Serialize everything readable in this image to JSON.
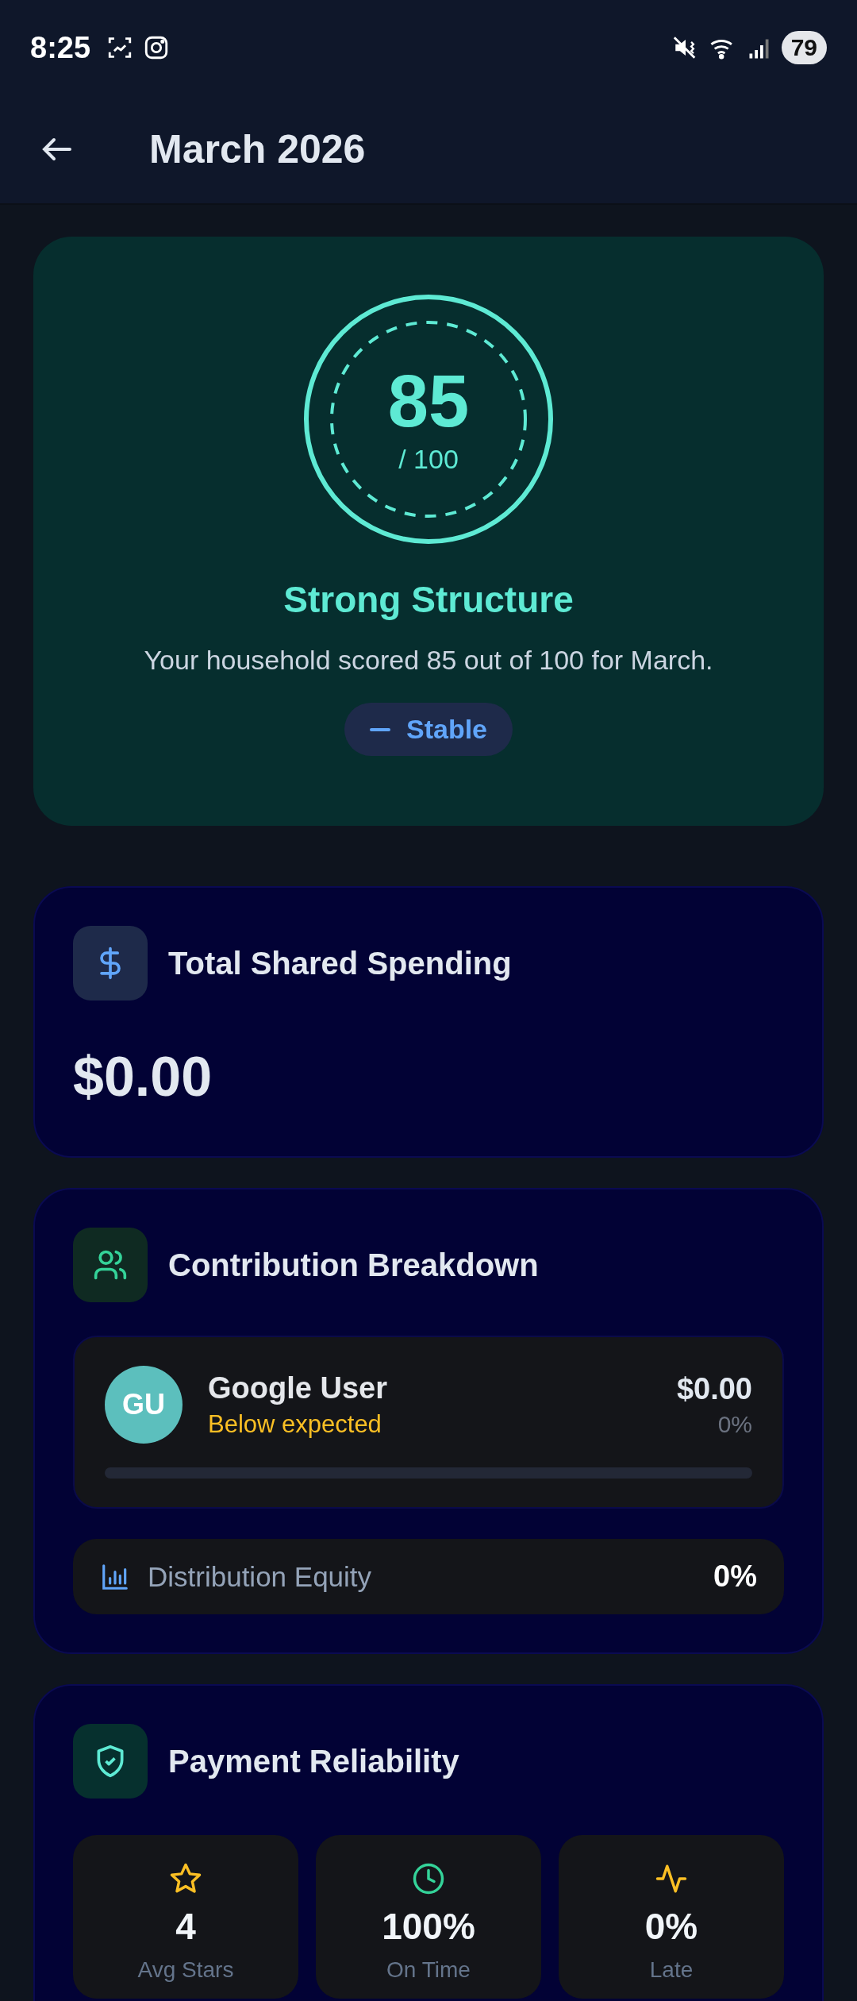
{
  "status_bar": {
    "time": "8:25",
    "battery": "79"
  },
  "header": {
    "title": "March 2026"
  },
  "score": {
    "value": "85",
    "max": "/ 100",
    "rating": "Strong Structure",
    "summary": "Your household scored 85 out of 100 for March.",
    "trend": {
      "kind": "flat",
      "label": "Stable"
    }
  },
  "spending": {
    "title": "Total Shared Spending",
    "amount": "$0.00"
  },
  "contribution": {
    "title": "Contribution Breakdown",
    "members": [
      {
        "initials": "GU",
        "name": "Google User",
        "status": "Below expected",
        "amount": "$0.00",
        "share": "0%",
        "level": 0
      }
    ],
    "equity": {
      "label": "Distribution Equity",
      "value": "0%"
    }
  },
  "reliability": {
    "title": "Payment Reliability",
    "stats": [
      {
        "kind": "stars",
        "value": "4",
        "label": "Avg Stars"
      },
      {
        "kind": "clock",
        "value": "100%",
        "label": "On Time"
      },
      {
        "kind": "pulse",
        "value": "0%",
        "label": "Late"
      }
    ]
  }
}
